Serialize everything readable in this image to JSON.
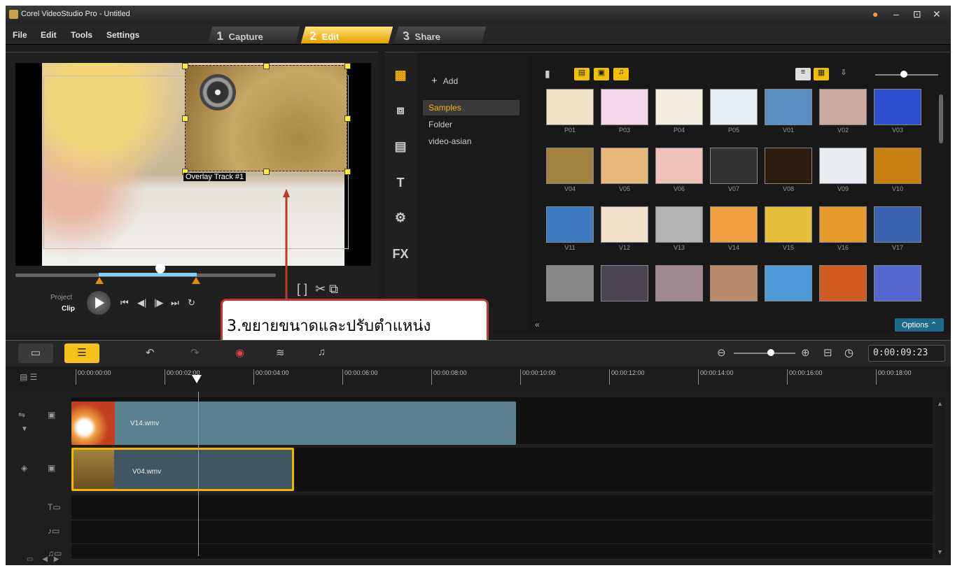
{
  "window": {
    "title": "Corel VideoStudio Pro - Untitled",
    "controls": [
      "●",
      "–",
      "⊡",
      "✕"
    ]
  },
  "menu": [
    "File",
    "Edit",
    "Tools",
    "Settings"
  ],
  "steps": [
    {
      "num": "1",
      "label": "Capture",
      "active": false
    },
    {
      "num": "2",
      "label": "Edit",
      "active": true
    },
    {
      "num": "3",
      "label": "Share",
      "active": false
    }
  ],
  "preview": {
    "overlay_label": "Overlay Track #1",
    "project_label": "Project",
    "clip_label": "Clip",
    "controls": [
      "⏮",
      "◀|",
      "|▶",
      "⏭",
      "↻"
    ],
    "right_buttons": [
      "[",
      "]",
      "✂",
      "⧉"
    ]
  },
  "sidebar": [
    {
      "icon": "media-icon",
      "glyph": "▦",
      "selected": true
    },
    {
      "icon": "transition-icon",
      "glyph": "⧈",
      "selected": false
    },
    {
      "icon": "graphic-icon",
      "glyph": "▤",
      "selected": false
    },
    {
      "icon": "title-icon",
      "glyph": "T",
      "selected": false
    },
    {
      "icon": "filter-icon",
      "glyph": "⚙",
      "selected": false
    },
    {
      "icon": "fx-icon",
      "glyph": "FX",
      "selected": false
    }
  ],
  "library": {
    "add_label": "Add",
    "tree": [
      {
        "label": "Samples",
        "selected": true
      },
      {
        "label": "Folder",
        "selected": false
      },
      {
        "label": "video-asian",
        "selected": false
      }
    ],
    "toolbar": [
      "📁",
      "▤",
      "▣",
      "♫"
    ],
    "options_label": "Options",
    "thumbnails": [
      {
        "label": "P01",
        "color": "#efe4c6"
      },
      {
        "label": "P03",
        "color": "#f4d9ec"
      },
      {
        "label": "P04",
        "color": "#f3eee0"
      },
      {
        "label": "P05",
        "color": "#e7eef6"
      },
      {
        "label": "V01",
        "color": "#5c8dc2"
      },
      {
        "label": "V02",
        "color": "#caa8a0"
      },
      {
        "label": "V03",
        "color": "#2e4fd0"
      },
      {
        "label": "V04",
        "color": "#a3823f"
      },
      {
        "label": "V05",
        "color": "#e8b87a"
      },
      {
        "label": "V06",
        "color": "#efc1b8"
      },
      {
        "label": "V07",
        "color": "#333333"
      },
      {
        "label": "V08",
        "color": "#2b1e10"
      },
      {
        "label": "V09",
        "color": "#e7ebf0"
      },
      {
        "label": "V10",
        "color": "#c88010"
      },
      {
        "label": "V11",
        "color": "#3d7cc0"
      },
      {
        "label": "V12",
        "color": "#f1e2cc"
      },
      {
        "label": "V13",
        "color": "#b4b4b4"
      },
      {
        "label": "V14",
        "color": "#f0a040"
      },
      {
        "label": "V15",
        "color": "#e6c03a"
      },
      {
        "label": "V16",
        "color": "#e59a2a"
      },
      {
        "label": "V17",
        "color": "#3a63b0"
      },
      {
        "label": "",
        "color": "#888888"
      },
      {
        "label": "",
        "color": "#4a4450"
      },
      {
        "label": "",
        "color": "#a08890"
      },
      {
        "label": "",
        "color": "#b88a6a"
      },
      {
        "label": "",
        "color": "#4f9ad8"
      },
      {
        "label": "",
        "color": "#d05a20"
      },
      {
        "label": "",
        "color": "#5468d0"
      }
    ]
  },
  "annotation": {
    "text": "3.ขยายขนาดและปรับตำแหน่ง",
    "color": "#c0392b"
  },
  "timeline": {
    "timecode": "0:00:09:23",
    "ruler": [
      "00:00:00:00",
      "00:00:02:00",
      "00:00:04:00",
      "00:00:06:00",
      "00:00:08:00",
      "00:00:10:00",
      "00:00:12:00",
      "00:00:14:00",
      "00:00:16:00",
      "00:00:18:00"
    ],
    "clips": [
      {
        "label": "V14.wmv",
        "track": "video"
      },
      {
        "label": "V04.wmv",
        "track": "overlay"
      }
    ]
  },
  "colors": {
    "accent": "#f4c21a",
    "panel": "#1c1c1c",
    "clip_video": "#5b8090",
    "clip_overlay": "#3f5764",
    "selection": "#f4b400"
  }
}
